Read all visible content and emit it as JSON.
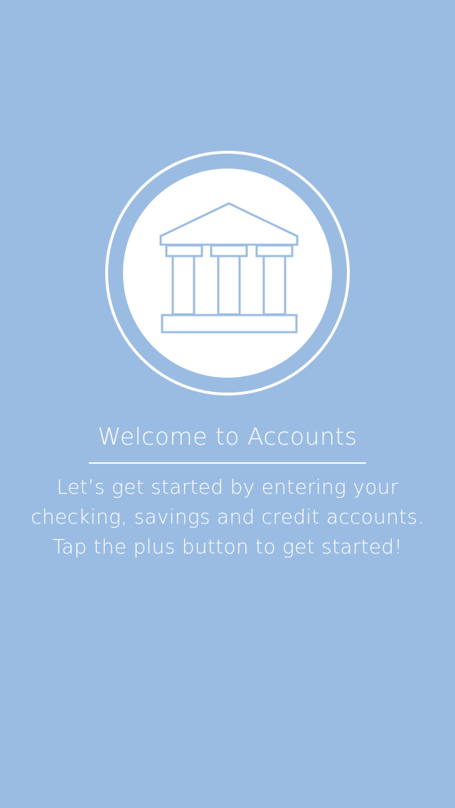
{
  "colors": {
    "background": "#9bbce2",
    "foreground": "#ffffff",
    "icon_stroke": "#9bbce2"
  },
  "icon": {
    "name": "bank-icon"
  },
  "welcome": {
    "title": "Welcome to Accounts",
    "message": "Let’s get started by entering your checking, savings and credit accounts. Tap the plus button to get started!"
  }
}
